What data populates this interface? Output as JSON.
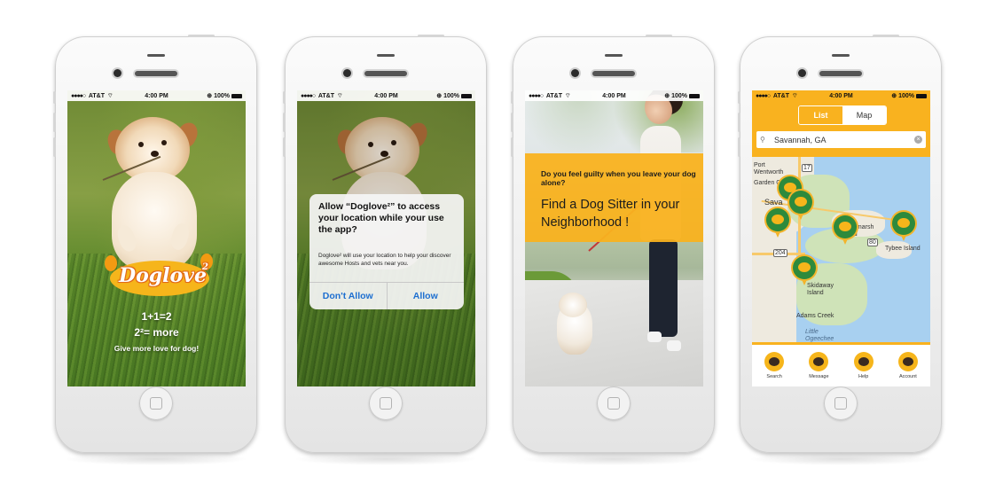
{
  "status_bar": {
    "carrier": "AT&T",
    "signal": "●●●●○",
    "time": "4:00 PM",
    "battery": "100%"
  },
  "screen1": {
    "logo_text": "Doglove",
    "logo_superscript": "2",
    "tagline_line1": "1+1=2",
    "tagline_line2": "2²= more",
    "tagline_line3": "Give more love for dog!"
  },
  "screen2": {
    "alert_title": "Allow “Doglove²” to access your location while your use the app?",
    "alert_message": "Doglove² will use your location to help your discover awesome Hosts and vets near you.",
    "btn_dont_allow": "Don't Allow",
    "btn_allow": "Allow"
  },
  "screen3": {
    "question": "Do you feel guilty when you leave your dog alone?",
    "headline": "Find a Dog Sitter in your Neighborhood !"
  },
  "screen4": {
    "tab_list": "List",
    "tab_map": "Map",
    "search_value": "Savannah, GA",
    "map_labels": [
      "Port Wentworth",
      "Garden City",
      "Sava",
      "Whitemarsh Island",
      "Tybee Island",
      "Skidaway Island",
      "Adams Creek",
      "Little Ogeechee"
    ],
    "highway_shields": [
      "17",
      "80",
      "204"
    ],
    "tabbar": [
      "Search",
      "Message",
      "Help",
      "Account"
    ]
  },
  "colors": {
    "brand_yellow": "#f9b21f",
    "pin_green": "#2e8a3c",
    "alert_link_blue": "#1e6fd0",
    "logo_orange": "#e26a1a"
  }
}
